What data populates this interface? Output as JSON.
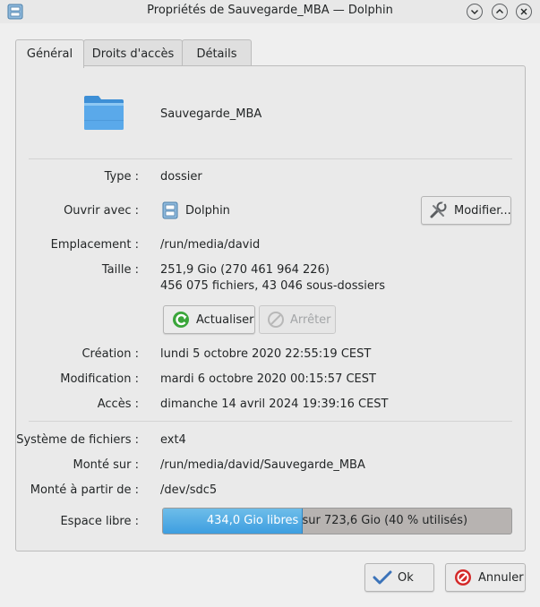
{
  "window": {
    "title": "Propriétés de Sauvegarde_MBA — Dolphin"
  },
  "tabs": [
    {
      "label": "Général"
    },
    {
      "label": "Droits d'accès"
    },
    {
      "label": "Détails"
    }
  ],
  "general": {
    "name": "Sauvegarde_MBA",
    "type_label": "Type :",
    "type_value": "dossier",
    "open_with_label": "Ouvrir avec :",
    "open_with_value": "Dolphin",
    "modify_button": "Modifier...",
    "location_label": "Emplacement :",
    "location_value": "/run/media/david",
    "size_label": "Taille :",
    "size_value": "251,9 Gio (270 461 964 226)",
    "size_counts": "456 075 fichiers, 43 046 sous-dossiers",
    "refresh_button": "Actualiser",
    "stop_button": "Arrêter",
    "created_label": "Création :",
    "created_value": "lundi 5 octobre 2020 22:55:19 CEST",
    "modified_label": "Modification :",
    "modified_value": "mardi 6 octobre 2020 00:15:57 CEST",
    "accessed_label": "Accès :",
    "accessed_value": "dimanche 14 avril 2024 19:39:16 CEST",
    "filesystem_label": "Système de fichiers :",
    "filesystem_value": "ext4",
    "mounted_on_label": "Monté sur :",
    "mounted_on_value": "/run/media/david/Sauvegarde_MBA",
    "mounted_from_label": "Monté à partir de :",
    "mounted_from_value": "/dev/sdc5",
    "free_space_label": "Espace libre :",
    "free_space_text_a": "434,0 Gio libres",
    "free_space_text_b": " sur 723,6 Gio (40 % utilisés)",
    "free_fraction": 0.4
  },
  "footer": {
    "ok_button": "Ok",
    "cancel_button": "Annuler"
  },
  "colors": {
    "accent": "#3d9ee0",
    "window_bg": "#efefef"
  }
}
